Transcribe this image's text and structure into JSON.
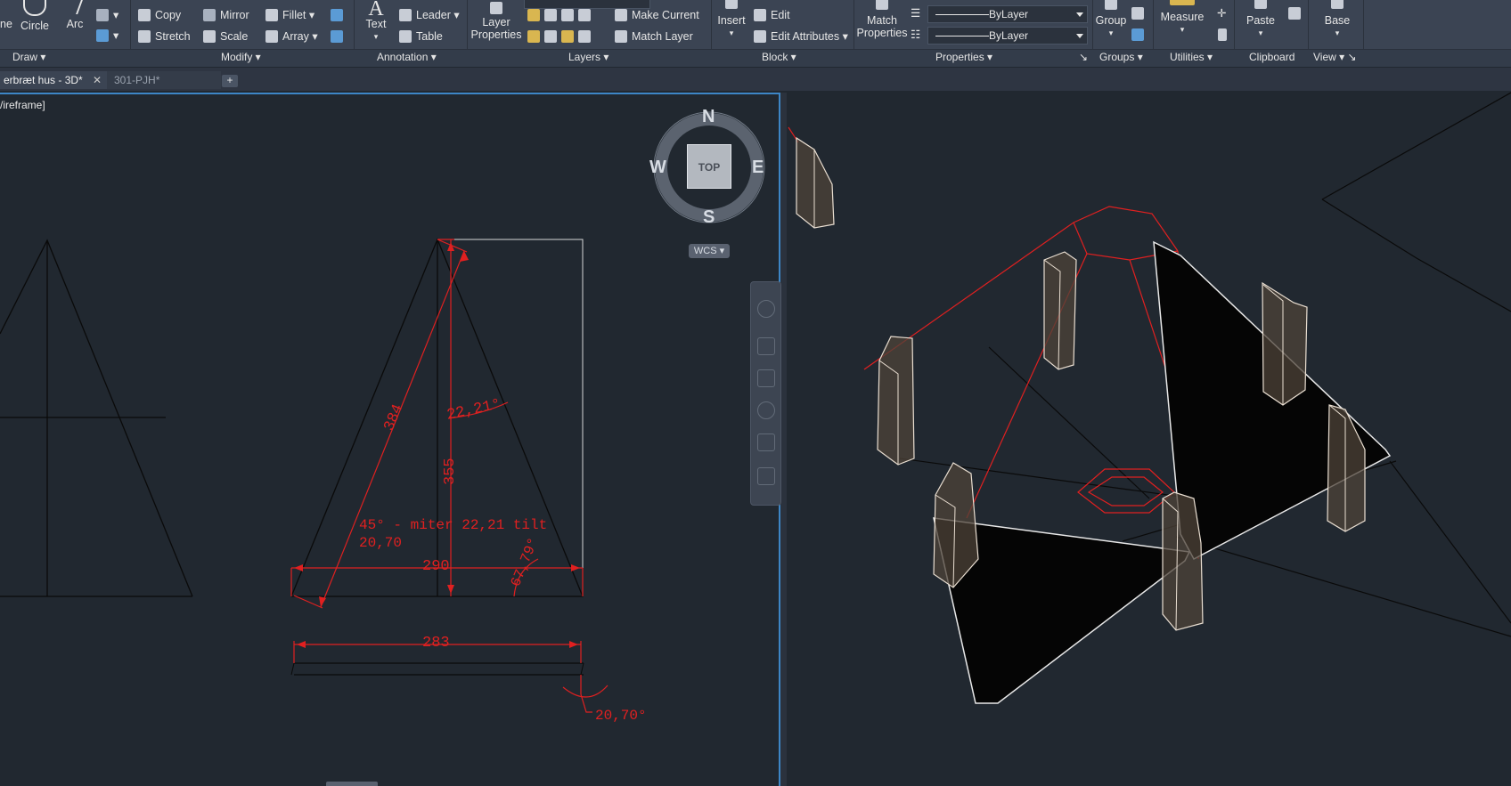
{
  "ribbon": {
    "draw": {
      "circle": "Circle",
      "arc": "Arc",
      "line_partial": "ne",
      "panel": "Draw"
    },
    "modify": {
      "copy": "Copy",
      "mirror": "Mirror",
      "fillet": "Fillet",
      "stretch": "Stretch",
      "scale": "Scale",
      "array": "Array",
      "panel": "Modify"
    },
    "annotation": {
      "text": "Text",
      "leader": "Leader",
      "table": "Table",
      "panel": "Annotation"
    },
    "layers": {
      "layer_properties_1": "Layer",
      "layer_properties_2": "Properties",
      "make_current": "Make Current",
      "match_layer": "Match Layer",
      "panel": "Layers"
    },
    "block": {
      "insert": "Insert",
      "edit": "Edit",
      "edit_attributes": "Edit Attributes",
      "panel": "Block"
    },
    "properties": {
      "match_1": "Match",
      "match_2": "Properties",
      "linetype": "ByLayer",
      "lineweight": "ByLayer",
      "panel": "Properties"
    },
    "groups": {
      "group": "Group",
      "panel": "Groups"
    },
    "utilities": {
      "measure": "Measure",
      "panel": "Utilities"
    },
    "clipboard": {
      "paste": "Paste",
      "panel": "Clipboard"
    },
    "view": {
      "base": "Base",
      "panel": "View"
    }
  },
  "tabs": [
    {
      "label": "erbræt hus - 3D*"
    },
    {
      "label": "301-PJH*"
    }
  ],
  "viewport_left": {
    "label": "/ireframe]",
    "compass": {
      "n": "N",
      "s": "S",
      "e": "E",
      "w": "W",
      "top": "TOP"
    },
    "wcs": "WCS",
    "dims": {
      "d384": "384",
      "d355": "355",
      "d2221": "22,21°",
      "note1": "45° - miter 22,21 tilt",
      "note2": "20,70",
      "d290": "290",
      "d6779": "67,79°",
      "d283": "283",
      "d2070": "20,70°"
    }
  },
  "colors": {
    "ribbon_bg": "#3b4453",
    "drawing_bg": "#212830",
    "dim_red": "#e02020",
    "active_border": "#3d86c6"
  }
}
